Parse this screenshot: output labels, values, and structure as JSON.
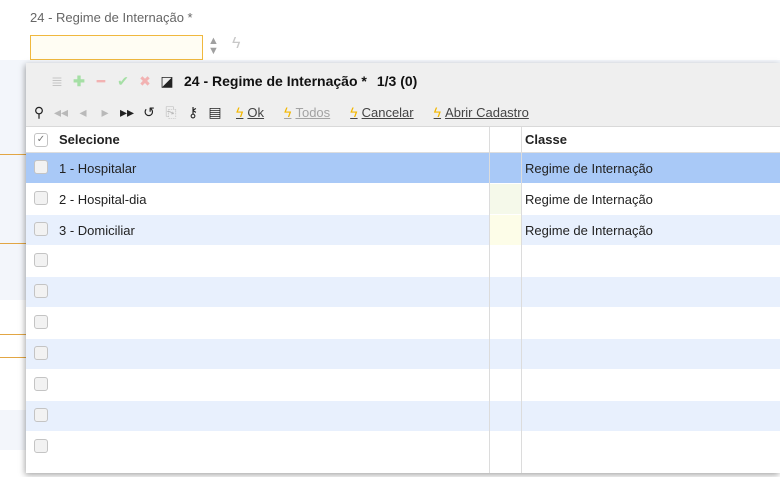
{
  "field": {
    "label": "24 - Regime de Internação *",
    "value": "",
    "spin_icon": "spinner-updown-icon",
    "action_icon": "lightning-icon"
  },
  "popup": {
    "title": "24 - Regime de Internação *",
    "counter": "1/3 (0)",
    "toolbar_icons_row1": [
      "list-icon",
      "add-icon",
      "remove-icon",
      "confirm-icon",
      "delete-icon",
      "window-icon"
    ],
    "toolbar_icons_row2": [
      "search-icon",
      "first-icon",
      "previous-icon",
      "next-icon",
      "last-icon",
      "undo-icon",
      "export-icon",
      "key-icon",
      "grid-icon"
    ],
    "actions": {
      "ok": "Ok",
      "todos": "Todos",
      "cancelar": "Cancelar",
      "abrir_cadastro": "Abrir Cadastro"
    },
    "columns": {
      "select": "Selecione",
      "class": "Classe"
    },
    "rows": [
      {
        "select": "1 - Hospitalar",
        "class": "Regime de Internação"
      },
      {
        "select": "2 - Hospital-dia",
        "class": "Regime de Internação"
      },
      {
        "select": "3 - Domiciliar",
        "class": "Regime de Internação"
      },
      {
        "select": "",
        "class": ""
      },
      {
        "select": "",
        "class": ""
      },
      {
        "select": "",
        "class": ""
      },
      {
        "select": "",
        "class": ""
      },
      {
        "select": "",
        "class": ""
      },
      {
        "select": "",
        "class": ""
      },
      {
        "select": "",
        "class": ""
      }
    ]
  },
  "colors": {
    "selected_row": "#a9c9f7",
    "alt_row": "#e8f0fd",
    "field_border": "#f0b83e",
    "bolt": "#f3b700"
  }
}
